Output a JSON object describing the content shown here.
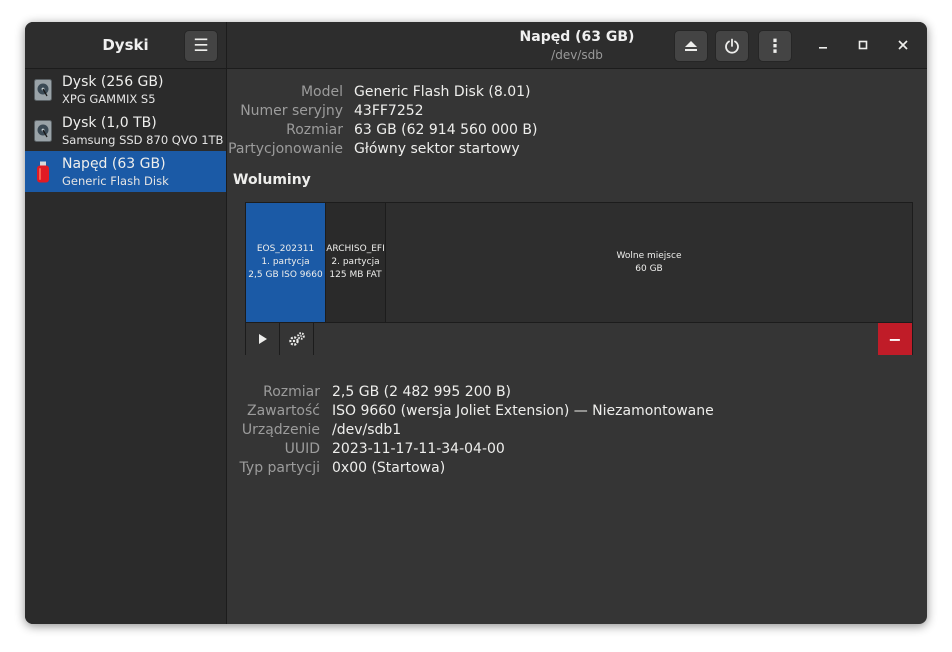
{
  "sidebar": {
    "title": "Dyski",
    "drives": [
      {
        "name": "Dysk (256 GB)",
        "subtitle": "XPG GAMMIX S5",
        "icon": "disk-icon"
      },
      {
        "name": "Dysk (1,0 TB)",
        "subtitle": "Samsung SSD 870 QVO 1TB",
        "icon": "disk-icon"
      },
      {
        "name": "Napęd (63 GB)",
        "subtitle": "Generic Flash Disk",
        "icon": "usb-drive-icon"
      }
    ],
    "selected_index": 2
  },
  "header": {
    "title": "Napęd (63 GB)",
    "subtitle": "/dev/sdb"
  },
  "drive_info": {
    "model_label": "Model",
    "model_value": "Generic Flash Disk (8.01)",
    "serial_label": "Numer seryjny",
    "serial_value": "43FF7252",
    "size_label": "Rozmiar",
    "size_value": "63 GB (62 914 560 000 B)",
    "partitioning_label": "Partycjonowanie",
    "partitioning_value": "Główny sektor startowy"
  },
  "volumes": {
    "title": "Woluminy",
    "partitions": [
      {
        "line1": "EOS_202311",
        "line2": "1. partycja",
        "line3": "2,5 GB ISO 9660"
      },
      {
        "line1": "ARCHISO_EFI",
        "line2": "2. partycja",
        "line3": "125 MB FAT"
      },
      {
        "line1": "Wolne miejsce",
        "line2": "60 GB"
      }
    ]
  },
  "partition_info": {
    "size_label": "Rozmiar",
    "size_value": "2,5 GB (2 482 995 200 B)",
    "content_label": "Zawartość",
    "content_value": "ISO 9660 (wersja Joliet Extension) — Niezamontowane",
    "device_label": "Urządzenie",
    "device_value": "/dev/sdb1",
    "uuid_label": "UUID",
    "uuid_value": "2023-11-17-11-34-04-00",
    "type_label": "Typ partycji",
    "type_value": "0x00 (Startowa)"
  },
  "colors": {
    "accent": "#1b5aa6",
    "destructive": "#c01c28",
    "background": "#353535"
  }
}
